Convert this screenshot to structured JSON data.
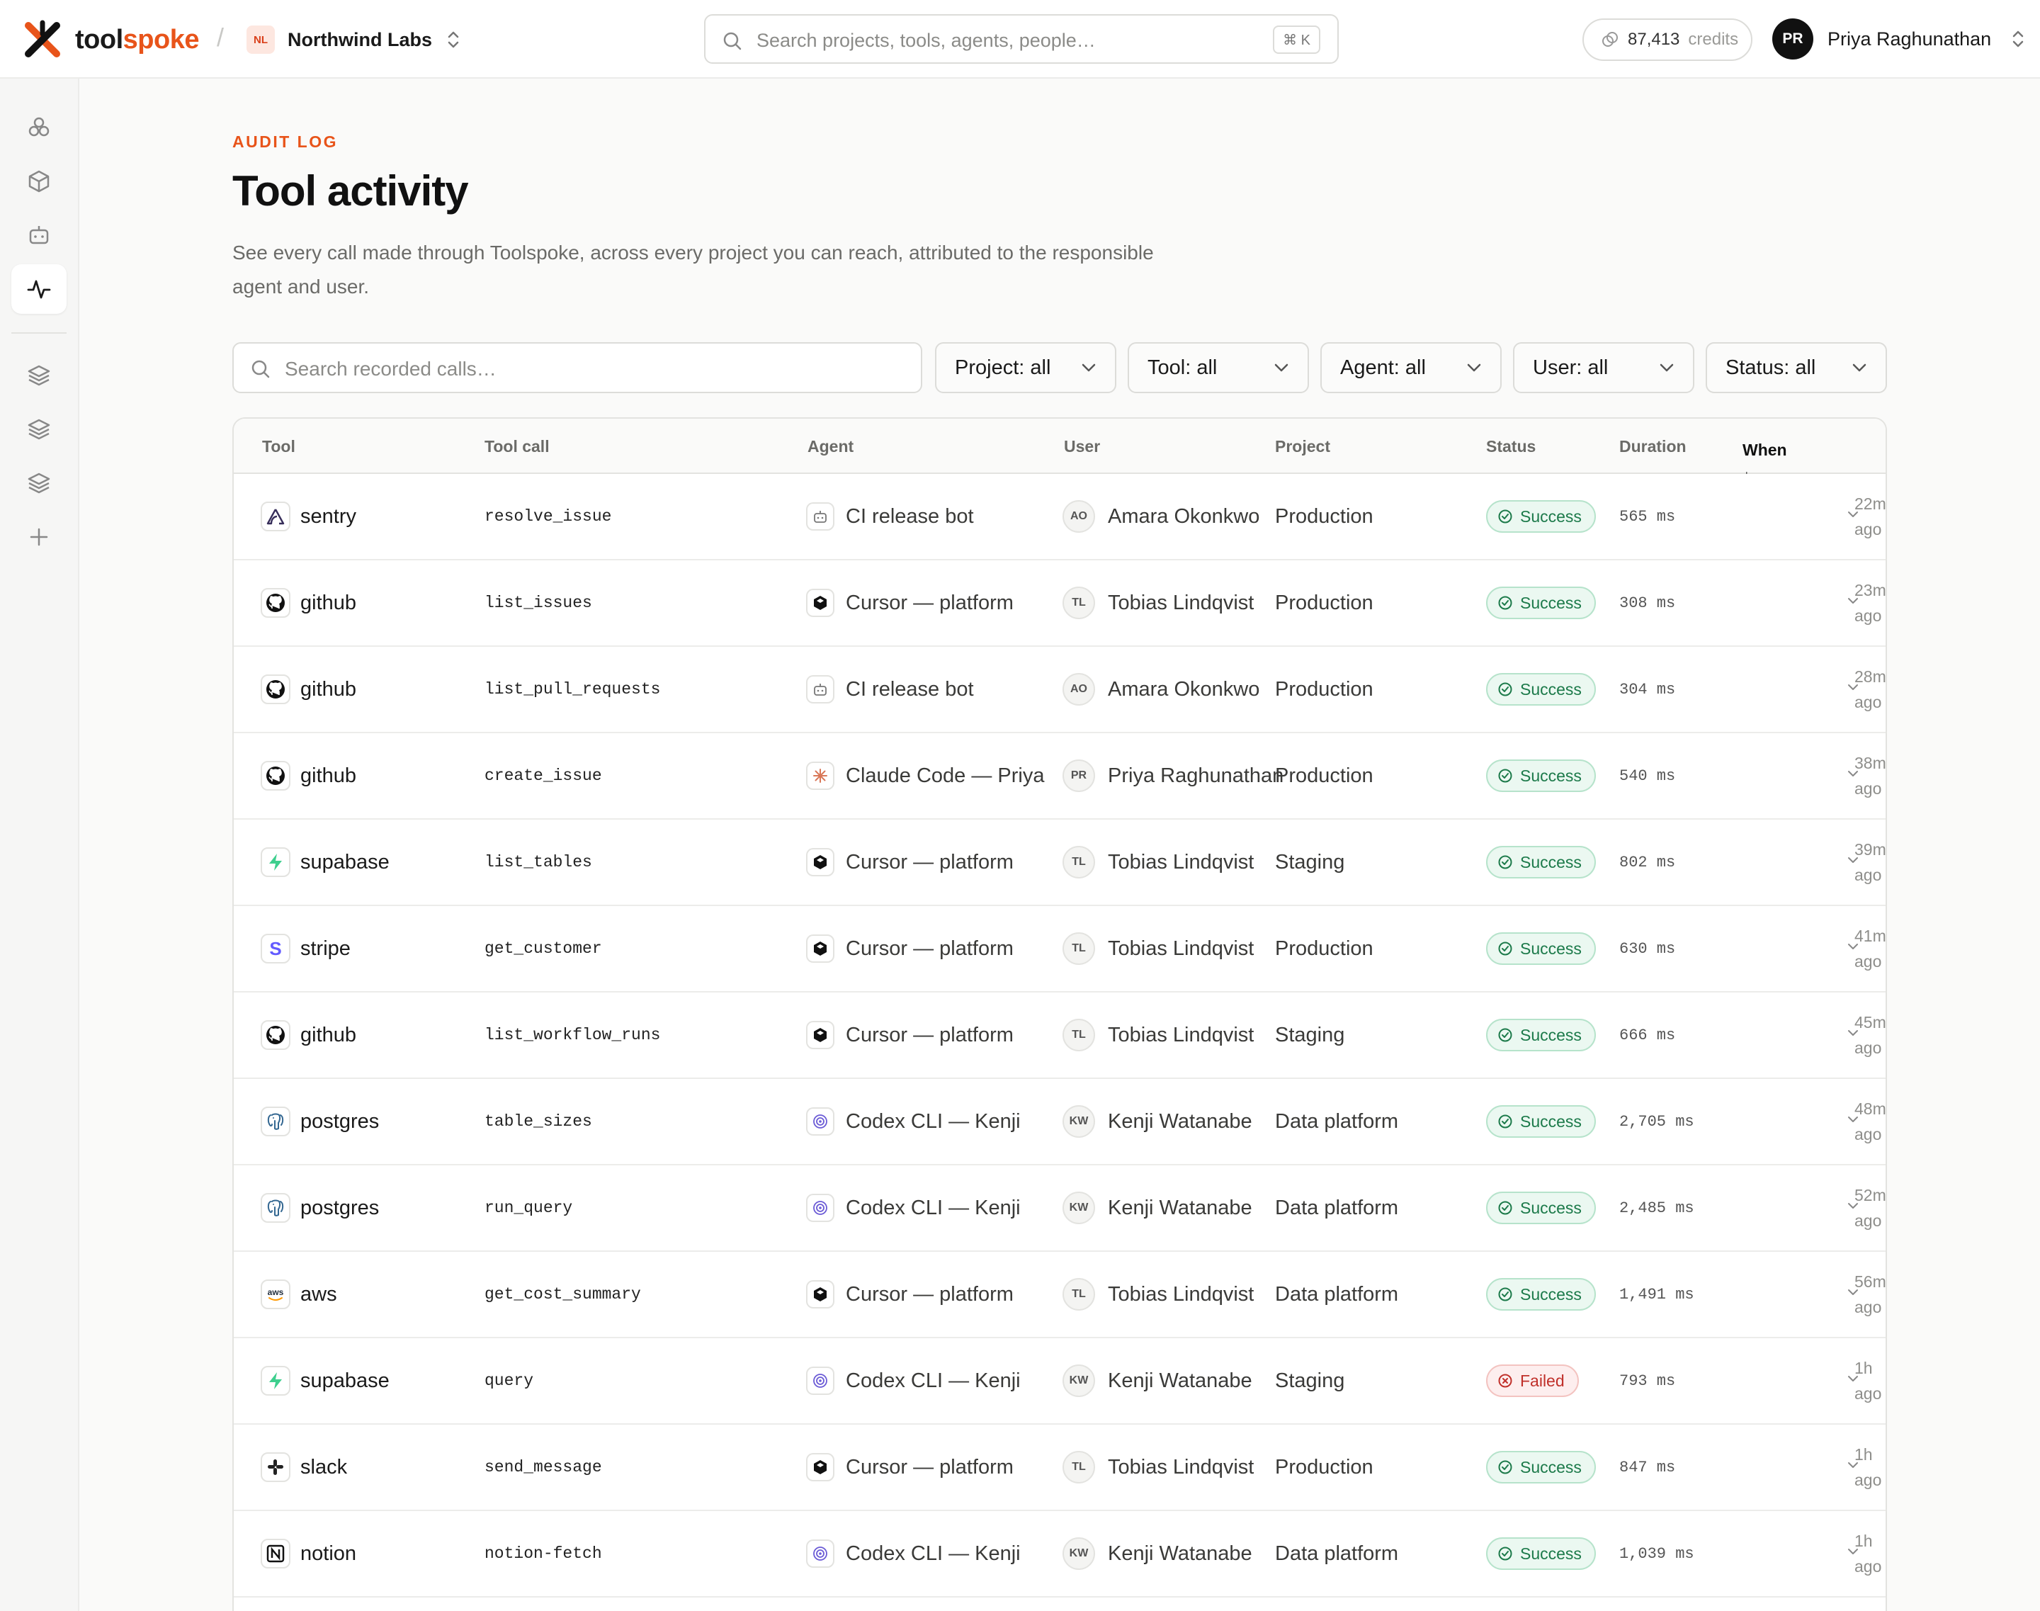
{
  "app": {
    "logo_prefix": "tool",
    "logo_suffix": "spoke",
    "separator": "/",
    "org_badge": "NL",
    "org_name": "Northwind Labs",
    "search_placeholder": "Search projects, tools, agents, people…",
    "search_shortcut": "⌘ K",
    "credits_value": "87,413",
    "credits_label": "credits",
    "user_initials": "PR",
    "user_name": "Priya Raghunathan",
    "accent_color": "#e8541a"
  },
  "sidebar": {
    "items": [
      {
        "icon": "agents-icon",
        "active": false
      },
      {
        "icon": "tools-icon",
        "active": false
      },
      {
        "icon": "bot-icon",
        "active": false
      },
      {
        "icon": "activity-icon",
        "active": true
      },
      {
        "icon": "layers-icon",
        "active": false
      },
      {
        "icon": "layers-icon",
        "active": false
      },
      {
        "icon": "layers-icon",
        "active": false
      },
      {
        "icon": "plus-icon",
        "active": false
      }
    ]
  },
  "page": {
    "eyebrow": "AUDIT LOG",
    "title": "Tool activity",
    "description": "See every call made through Toolspoke, across every project you can reach, attributed to the responsible agent and user.",
    "search_placeholder": "Search recorded calls…",
    "filters": [
      "Project: all",
      "Tool: all",
      "Agent: all",
      "User: all",
      "Status: all"
    ]
  },
  "table": {
    "columns": [
      "Tool",
      "Tool call",
      "Agent",
      "User",
      "Project",
      "Status",
      "Duration",
      "When"
    ],
    "sort_indicator": "↓",
    "rows": [
      {
        "tool": "sentry",
        "tool_icon": "sentry-icon",
        "call": "resolve_issue",
        "agent": "CI release bot",
        "agent_icon": "bot-icon",
        "user_initials": "AO",
        "user": "Amara Okonkwo",
        "project": "Production",
        "status": "Success",
        "duration": "565 ms",
        "when_1": "22m",
        "when_2": "ago"
      },
      {
        "tool": "github",
        "tool_icon": "github-icon",
        "call": "list_issues",
        "agent": "Cursor — platform",
        "agent_icon": "cursor-icon",
        "user_initials": "TL",
        "user": "Tobias Lindqvist",
        "project": "Production",
        "status": "Success",
        "duration": "308 ms",
        "when_1": "23m",
        "when_2": "ago"
      },
      {
        "tool": "github",
        "tool_icon": "github-icon",
        "call": "list_pull_requests",
        "agent": "CI release bot",
        "agent_icon": "bot-icon",
        "user_initials": "AO",
        "user": "Amara Okonkwo",
        "project": "Production",
        "status": "Success",
        "duration": "304 ms",
        "when_1": "28m",
        "when_2": "ago"
      },
      {
        "tool": "github",
        "tool_icon": "github-icon",
        "call": "create_issue",
        "agent": "Claude Code — Priya",
        "agent_icon": "claude-icon",
        "user_initials": "PR",
        "user": "Priya Raghunathan",
        "project": "Production",
        "status": "Success",
        "duration": "540 ms",
        "when_1": "38m",
        "when_2": "ago"
      },
      {
        "tool": "supabase",
        "tool_icon": "supabase-icon",
        "call": "list_tables",
        "agent": "Cursor — platform",
        "agent_icon": "cursor-icon",
        "user_initials": "TL",
        "user": "Tobias Lindqvist",
        "project": "Staging",
        "status": "Success",
        "duration": "802 ms",
        "when_1": "39m",
        "when_2": "ago"
      },
      {
        "tool": "stripe",
        "tool_icon": "stripe-icon",
        "call": "get_customer",
        "agent": "Cursor — platform",
        "agent_icon": "cursor-icon",
        "user_initials": "TL",
        "user": "Tobias Lindqvist",
        "project": "Production",
        "status": "Success",
        "duration": "630 ms",
        "when_1": "41m",
        "when_2": "ago"
      },
      {
        "tool": "github",
        "tool_icon": "github-icon",
        "call": "list_workflow_runs",
        "agent": "Cursor — platform",
        "agent_icon": "cursor-icon",
        "user_initials": "TL",
        "user": "Tobias Lindqvist",
        "project": "Staging",
        "status": "Success",
        "duration": "666 ms",
        "when_1": "45m",
        "when_2": "ago"
      },
      {
        "tool": "postgres",
        "tool_icon": "postgres-icon",
        "call": "table_sizes",
        "agent": "Codex CLI — Kenji",
        "agent_icon": "codex-icon",
        "user_initials": "KW",
        "user": "Kenji Watanabe",
        "project": "Data platform",
        "status": "Success",
        "duration": "2,705 ms",
        "when_1": "48m",
        "when_2": "ago"
      },
      {
        "tool": "postgres",
        "tool_icon": "postgres-icon",
        "call": "run_query",
        "agent": "Codex CLI — Kenji",
        "agent_icon": "codex-icon",
        "user_initials": "KW",
        "user": "Kenji Watanabe",
        "project": "Data platform",
        "status": "Success",
        "duration": "2,485 ms",
        "when_1": "52m",
        "when_2": "ago"
      },
      {
        "tool": "aws",
        "tool_icon": "aws-icon",
        "call": "get_cost_summary",
        "agent": "Cursor — platform",
        "agent_icon": "cursor-icon",
        "user_initials": "TL",
        "user": "Tobias Lindqvist",
        "project": "Data platform",
        "status": "Success",
        "duration": "1,491 ms",
        "when_1": "56m",
        "when_2": "ago"
      },
      {
        "tool": "supabase",
        "tool_icon": "supabase-icon",
        "call": "query",
        "agent": "Codex CLI — Kenji",
        "agent_icon": "codex-icon",
        "user_initials": "KW",
        "user": "Kenji Watanabe",
        "project": "Staging",
        "status": "Failed",
        "duration": "793 ms",
        "when_1": "1h",
        "when_2": "ago"
      },
      {
        "tool": "slack",
        "tool_icon": "slack-icon",
        "call": "send_message",
        "agent": "Cursor — platform",
        "agent_icon": "cursor-icon",
        "user_initials": "TL",
        "user": "Tobias Lindqvist",
        "project": "Production",
        "status": "Success",
        "duration": "847 ms",
        "when_1": "1h",
        "when_2": "ago"
      },
      {
        "tool": "notion",
        "tool_icon": "notion-icon",
        "call": "notion-fetch",
        "agent": "Codex CLI — Kenji",
        "agent_icon": "codex-icon",
        "user_initials": "KW",
        "user": "Kenji Watanabe",
        "project": "Data platform",
        "status": "Success",
        "duration": "1,039 ms",
        "when_1": "1h",
        "when_2": "ago"
      }
    ]
  }
}
